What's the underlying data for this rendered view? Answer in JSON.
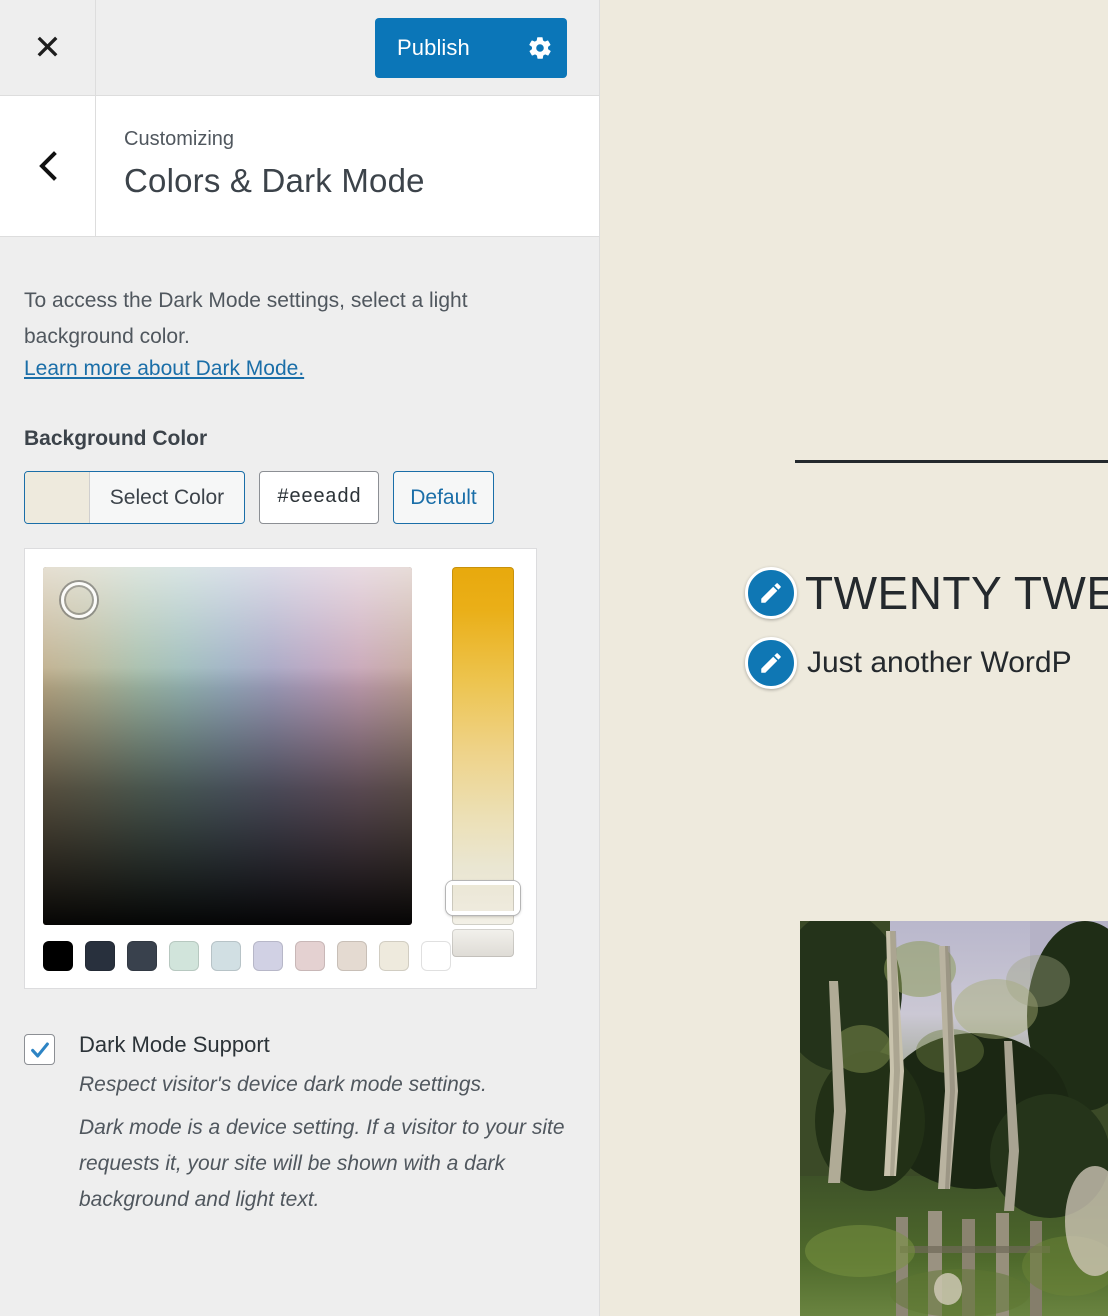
{
  "topbar": {
    "close_icon": "close-icon",
    "publish_label": "Publish",
    "gear_icon": "gear-icon",
    "publish_color": "#0b76b8"
  },
  "panel": {
    "back_icon": "chevron-left-icon",
    "kicker": "Customizing",
    "title": "Colors & Dark Mode"
  },
  "body": {
    "description": "To access the Dark Mode settings, select a light background color.",
    "learn_more_link": "Learn more about Dark Mode.",
    "section_label": "Background Color"
  },
  "color_control": {
    "select_color_label": "Select Color",
    "current_color": "#eeeadd",
    "hex_value": "#eeeadd",
    "default_label": "Default",
    "swatches": [
      "#000000",
      "#28303d",
      "#39414d",
      "#d1e4db",
      "#d1dfe3",
      "#d1d1e4",
      "#e4d1d1",
      "#e4dad1",
      "#eeeadd",
      "#ffffff"
    ]
  },
  "dark_mode": {
    "checkbox_checked": true,
    "label": "Dark Mode Support",
    "help_line_1": "Respect visitor's device dark mode settings.",
    "help_line_2": "Dark mode is a device setting. If a visitor to your site requests it, your site will be shown with a dark background and light text."
  },
  "preview": {
    "background_color": "#eeeadd",
    "edit_icon": "pencil-edit-icon",
    "site_title": "TWENTY TWE",
    "tagline": "Just another WordP",
    "featured_image_alt": "impressionist forest painting"
  }
}
